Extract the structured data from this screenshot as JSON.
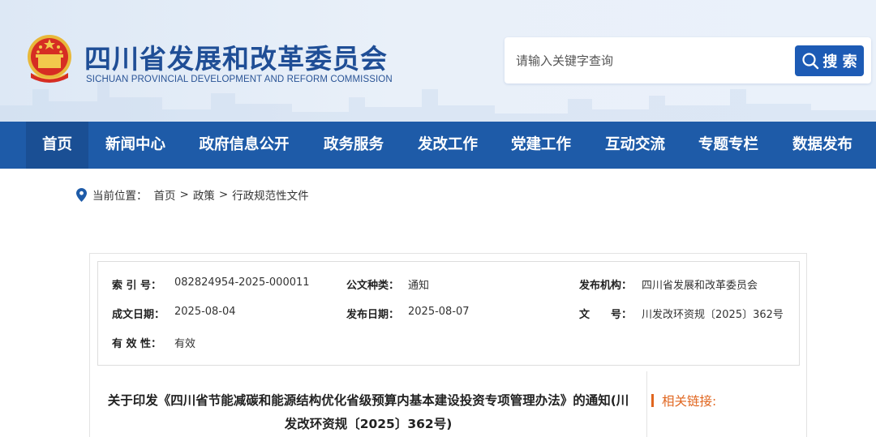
{
  "header": {
    "title": "四川省发展和改革委员会",
    "subtitle": "SICHUAN PROVINCIAL DEVELOPMENT AND REFORM COMMISSION",
    "emblem_icon": "national-emblem-icon",
    "search": {
      "placeholder": "请输入关键字查询",
      "button_label": "搜 索",
      "button_icon": "search-icon"
    }
  },
  "nav": {
    "items": [
      {
        "label": "首页",
        "active": true
      },
      {
        "label": "新闻中心"
      },
      {
        "label": "政府信息公开"
      },
      {
        "label": "政务服务"
      },
      {
        "label": "发改工作"
      },
      {
        "label": "党建工作"
      },
      {
        "label": "互动交流"
      },
      {
        "label": "专题专栏"
      },
      {
        "label": "数据发布"
      }
    ]
  },
  "breadcrumb": {
    "icon": "location-pin-icon",
    "prefix": "当前位置：",
    "items": [
      "首页",
      "政策",
      "行政规范性文件"
    ],
    "separator": ">"
  },
  "meta": {
    "index_no": {
      "label": "索 引 号：",
      "value": "082824954-2025-000011"
    },
    "doc_type": {
      "label": "公文种类：",
      "value": "通知"
    },
    "publisher": {
      "label": "发布机构：",
      "value": "四川省发展和改革委员会"
    },
    "created_date": {
      "label": "成文日期：",
      "value": "2025-08-04"
    },
    "publish_date": {
      "label": "发布日期：",
      "value": "2025-08-07"
    },
    "doc_no": {
      "label": "文　　号：",
      "value": "川发改环资规〔2025〕362号"
    },
    "validity": {
      "label": "有 效 性：",
      "value": "有效"
    }
  },
  "article": {
    "title": "关于印发《四川省节能减碳和能源结构优化省级预算内基本建设投资专项管理办法》的通知(川发改环资规〔2025〕362号)"
  },
  "sidebar": {
    "related_title": "相关链接:"
  },
  "colors": {
    "brand_blue": "#1e5ba8",
    "title_blue": "#1f4e96",
    "accent_orange": "#e0651e"
  }
}
